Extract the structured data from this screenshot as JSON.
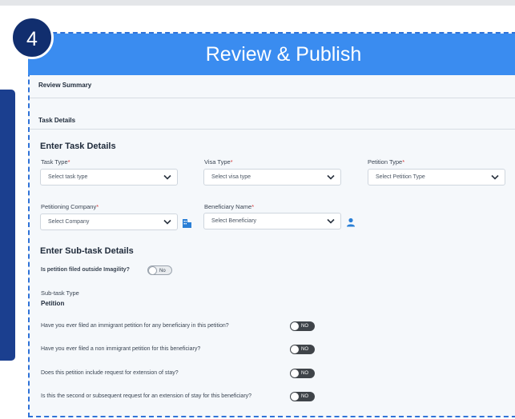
{
  "step": {
    "number": "4",
    "title": "Review & Publish"
  },
  "review_summary": "Review Summary",
  "task_details": "Task Details",
  "enter_task_details": "Enter Task Details",
  "fields": {
    "task_type": {
      "label": "Task Type",
      "required": "*",
      "placeholder": "Select task type"
    },
    "visa_type": {
      "label": "Visa Type",
      "required": "*",
      "placeholder": "Select visa type"
    },
    "petition_type": {
      "label": "Petition Type",
      "required": "*",
      "placeholder": "Select Petition Type"
    },
    "petitioning_company": {
      "label": "Petitioning Company",
      "required": "*",
      "placeholder": "Select Company"
    },
    "beneficiary_name": {
      "label": "Beneficiary Name",
      "required": "*",
      "placeholder": "Select Beneficiary"
    }
  },
  "enter_subtask_details": "Enter Sub-task Details",
  "outside_imagility": {
    "label": "Is petition filed outside Imagility?",
    "toggle": "No",
    "on": false
  },
  "subtask_type": {
    "label": "Sub-task Type",
    "value": "Petition"
  },
  "questions": [
    {
      "text": "Have you ever filed an immigrant petition for any beneficiary in this petition?",
      "toggle": "NO",
      "on": false
    },
    {
      "text": "Have you ever filed a non immigrant petition for this beneficiary?",
      "toggle": "NO",
      "on": false
    },
    {
      "text": "Does this petition include request for extension of stay?",
      "toggle": "NO",
      "on": false
    },
    {
      "text": "Is this the second or subsequent request for an extension of stay for this beneficiary?",
      "toggle": "NO",
      "on": false
    }
  ],
  "colors": {
    "banner": "#3a8cf0",
    "badge": "#112e6e",
    "sidepanel": "#1b3f8f",
    "required": "#d43a3a",
    "toggle_off": "#3f4449"
  },
  "icons": {
    "dropdown": "chevron-down-icon",
    "company": "building-icon",
    "beneficiary": "person-icon"
  }
}
